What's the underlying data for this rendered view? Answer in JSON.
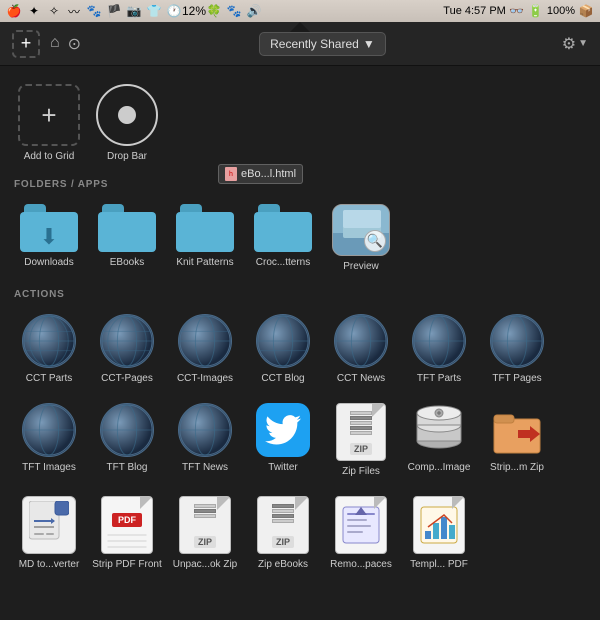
{
  "menubar": {
    "time": "Tue 4:57 PM",
    "battery": "100%",
    "battery_icon": "🔋",
    "percent": "12%"
  },
  "toolbar": {
    "add_label": "+",
    "dropdown_label": "Recently Shared",
    "dropdown_arrow": "▼",
    "gear_label": "⚙",
    "gear_arrow": "▼"
  },
  "top_items": [
    {
      "id": "add-to-grid",
      "label": "Add to Grid"
    },
    {
      "id": "drop-bar",
      "label": "Drop Bar"
    }
  ],
  "sections": {
    "folders_label": "FOLDERS / APPS",
    "actions_label": "ACTIONS"
  },
  "folders": [
    {
      "id": "downloads",
      "label": "Downloads",
      "type": "folder-dl"
    },
    {
      "id": "ebooks",
      "label": "EBooks",
      "type": "folder"
    },
    {
      "id": "knit-patterns",
      "label": "Knit Patterns",
      "type": "folder"
    },
    {
      "id": "crochet-patterns",
      "label": "Croc...tterns",
      "type": "folder"
    },
    {
      "id": "preview",
      "label": "Preview",
      "type": "preview"
    }
  ],
  "actions_row1": [
    {
      "id": "cct-parts",
      "label": "CCT Parts",
      "type": "globe"
    },
    {
      "id": "cct-pages",
      "label": "CCT-Pages",
      "type": "globe"
    },
    {
      "id": "cct-images",
      "label": "CCT-Images",
      "type": "globe"
    },
    {
      "id": "cct-blog",
      "label": "CCT Blog",
      "type": "globe"
    },
    {
      "id": "cct-news",
      "label": "CCT News",
      "type": "globe"
    },
    {
      "id": "tft-parts",
      "label": "TFT Parts",
      "type": "globe"
    },
    {
      "id": "tft-pages",
      "label": "TFT Pages",
      "type": "globe"
    }
  ],
  "actions_row2": [
    {
      "id": "tft-images",
      "label": "TFT Images",
      "type": "globe"
    },
    {
      "id": "tft-blog",
      "label": "TFT Blog",
      "type": "globe"
    },
    {
      "id": "tft-news",
      "label": "TFT News",
      "type": "globe"
    },
    {
      "id": "twitter",
      "label": "Twitter",
      "type": "twitter"
    },
    {
      "id": "zip-files",
      "label": "Zip Files",
      "type": "zip"
    },
    {
      "id": "comp-image",
      "label": "Comp...Image",
      "type": "comp"
    },
    {
      "id": "strip-zip",
      "label": "Strip...m Zip",
      "type": "strip"
    }
  ],
  "actions_row3": [
    {
      "id": "md-converter",
      "label": "MD to...verter",
      "type": "mdconv"
    },
    {
      "id": "strip-pdf",
      "label": "Strip PDF Front",
      "type": "strippdf"
    },
    {
      "id": "unpack-zip",
      "label": "Unpac...ok Zip",
      "type": "unpackzip"
    },
    {
      "id": "zip-ebooks",
      "label": "Zip eBooks",
      "type": "zipebooks"
    },
    {
      "id": "remove-spaces",
      "label": "Remo...paces",
      "type": "removespaces"
    },
    {
      "id": "templ-pdf",
      "label": "Templ... PDF",
      "type": "templpdf"
    }
  ],
  "dragging_file": "eBo...l.html"
}
